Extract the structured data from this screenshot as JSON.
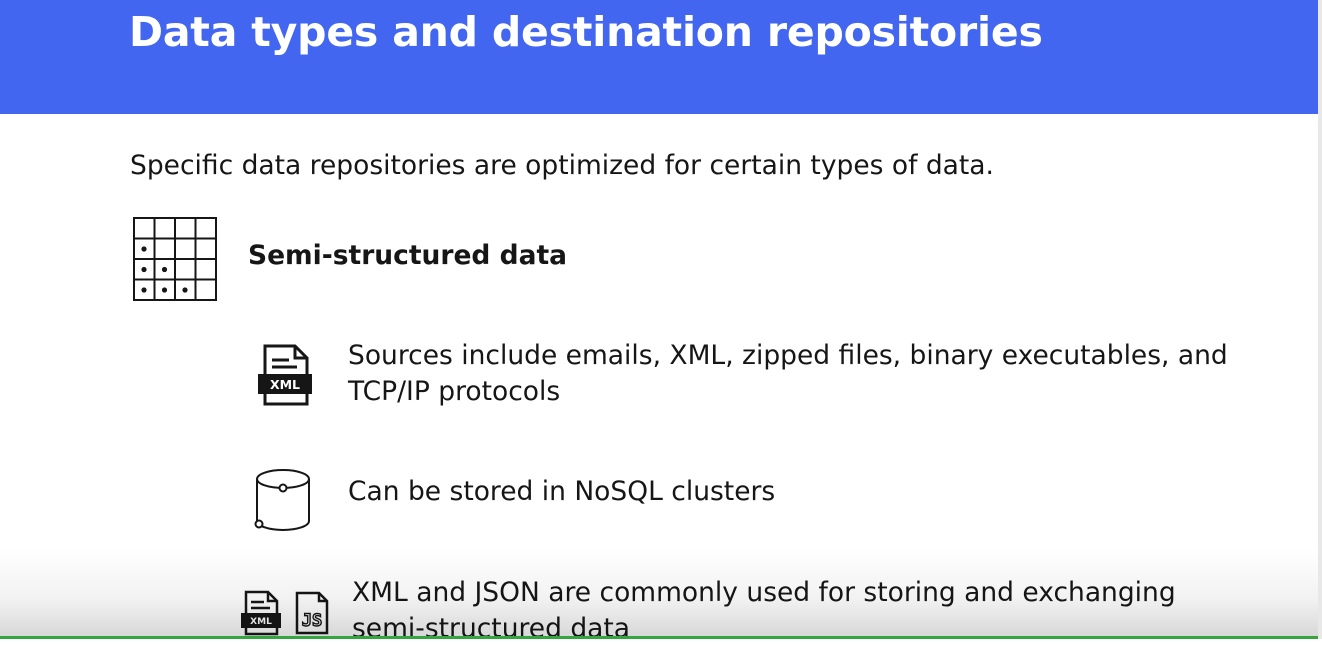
{
  "slide": {
    "title": "Data types and destination repositories",
    "intro": "Specific data repositories are optimized for certain types of data.",
    "section": {
      "icon": "semi-structured-grid-icon",
      "heading": "Semi-structured data"
    },
    "items": [
      {
        "icons": [
          "xml-document-icon"
        ],
        "text": "Sources include emails, XML, zipped files, binary executables, and TCP/IP protocols"
      },
      {
        "icons": [
          "database-cylinder-icon"
        ],
        "text": "Can be stored in NoSQL clusters"
      },
      {
        "icons": [
          "xml-document-icon",
          "json-file-icon"
        ],
        "text": "XML and JSON are commonly used for storing and exchanging semi-structured data"
      }
    ],
    "icon_labels": {
      "xml": "XML",
      "js": "JS"
    }
  },
  "colors": {
    "header_bg": "#4266ef",
    "title_text": "#ffffff",
    "body_text": "#161616",
    "progress": "#36a43f"
  }
}
